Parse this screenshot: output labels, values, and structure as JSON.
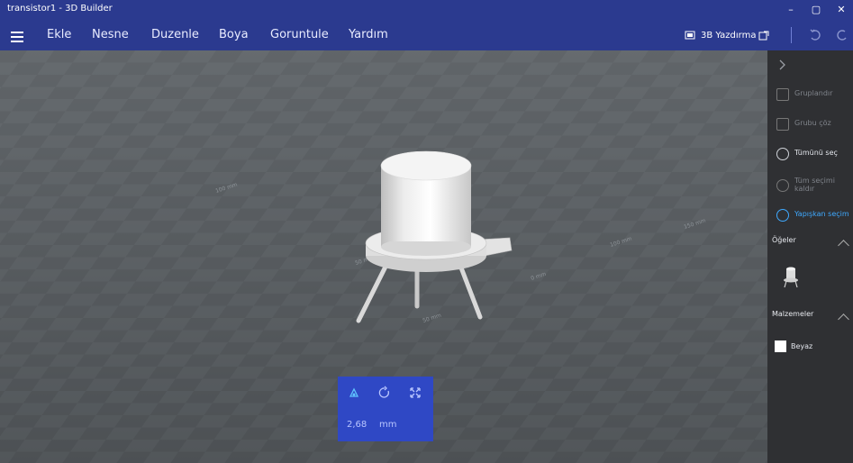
{
  "window": {
    "title": "transistor1 - 3D Builder"
  },
  "menu": {
    "items": [
      {
        "label": "Ekle"
      },
      {
        "label": "Nesne"
      },
      {
        "label": "Duzenle"
      },
      {
        "label": "Boya"
      },
      {
        "label": "Goruntule"
      },
      {
        "label": "Yardım"
      }
    ],
    "right": {
      "print_label": "3B Yazdırma"
    }
  },
  "panel": {
    "actions": [
      {
        "label": "Gruplandır",
        "enabled": false,
        "icon": "group-icon"
      },
      {
        "label": "Grubu çöz",
        "enabled": false,
        "icon": "ungroup-icon"
      },
      {
        "label": "Tümünü seç",
        "enabled": true,
        "icon": "select-all-icon"
      },
      {
        "label": "Tüm seçimi kaldır",
        "enabled": false,
        "icon": "deselect-icon"
      },
      {
        "label": "Yapışkan seçim",
        "enabled": true,
        "active": true,
        "icon": "sticky-select-icon"
      }
    ],
    "items_title": "Öğeler",
    "materials_title": "Malzemeler",
    "material": {
      "name": "Beyaz",
      "swatch_color": "#ffffff"
    }
  },
  "viewport": {
    "grid_labels": [
      "100 mm",
      "50 mm",
      "0 mm",
      "50 mm",
      "100 mm",
      "150 mm"
    ]
  },
  "control_box": {
    "value": "2,68",
    "unit": "mm",
    "accent": "#2f48c5"
  }
}
